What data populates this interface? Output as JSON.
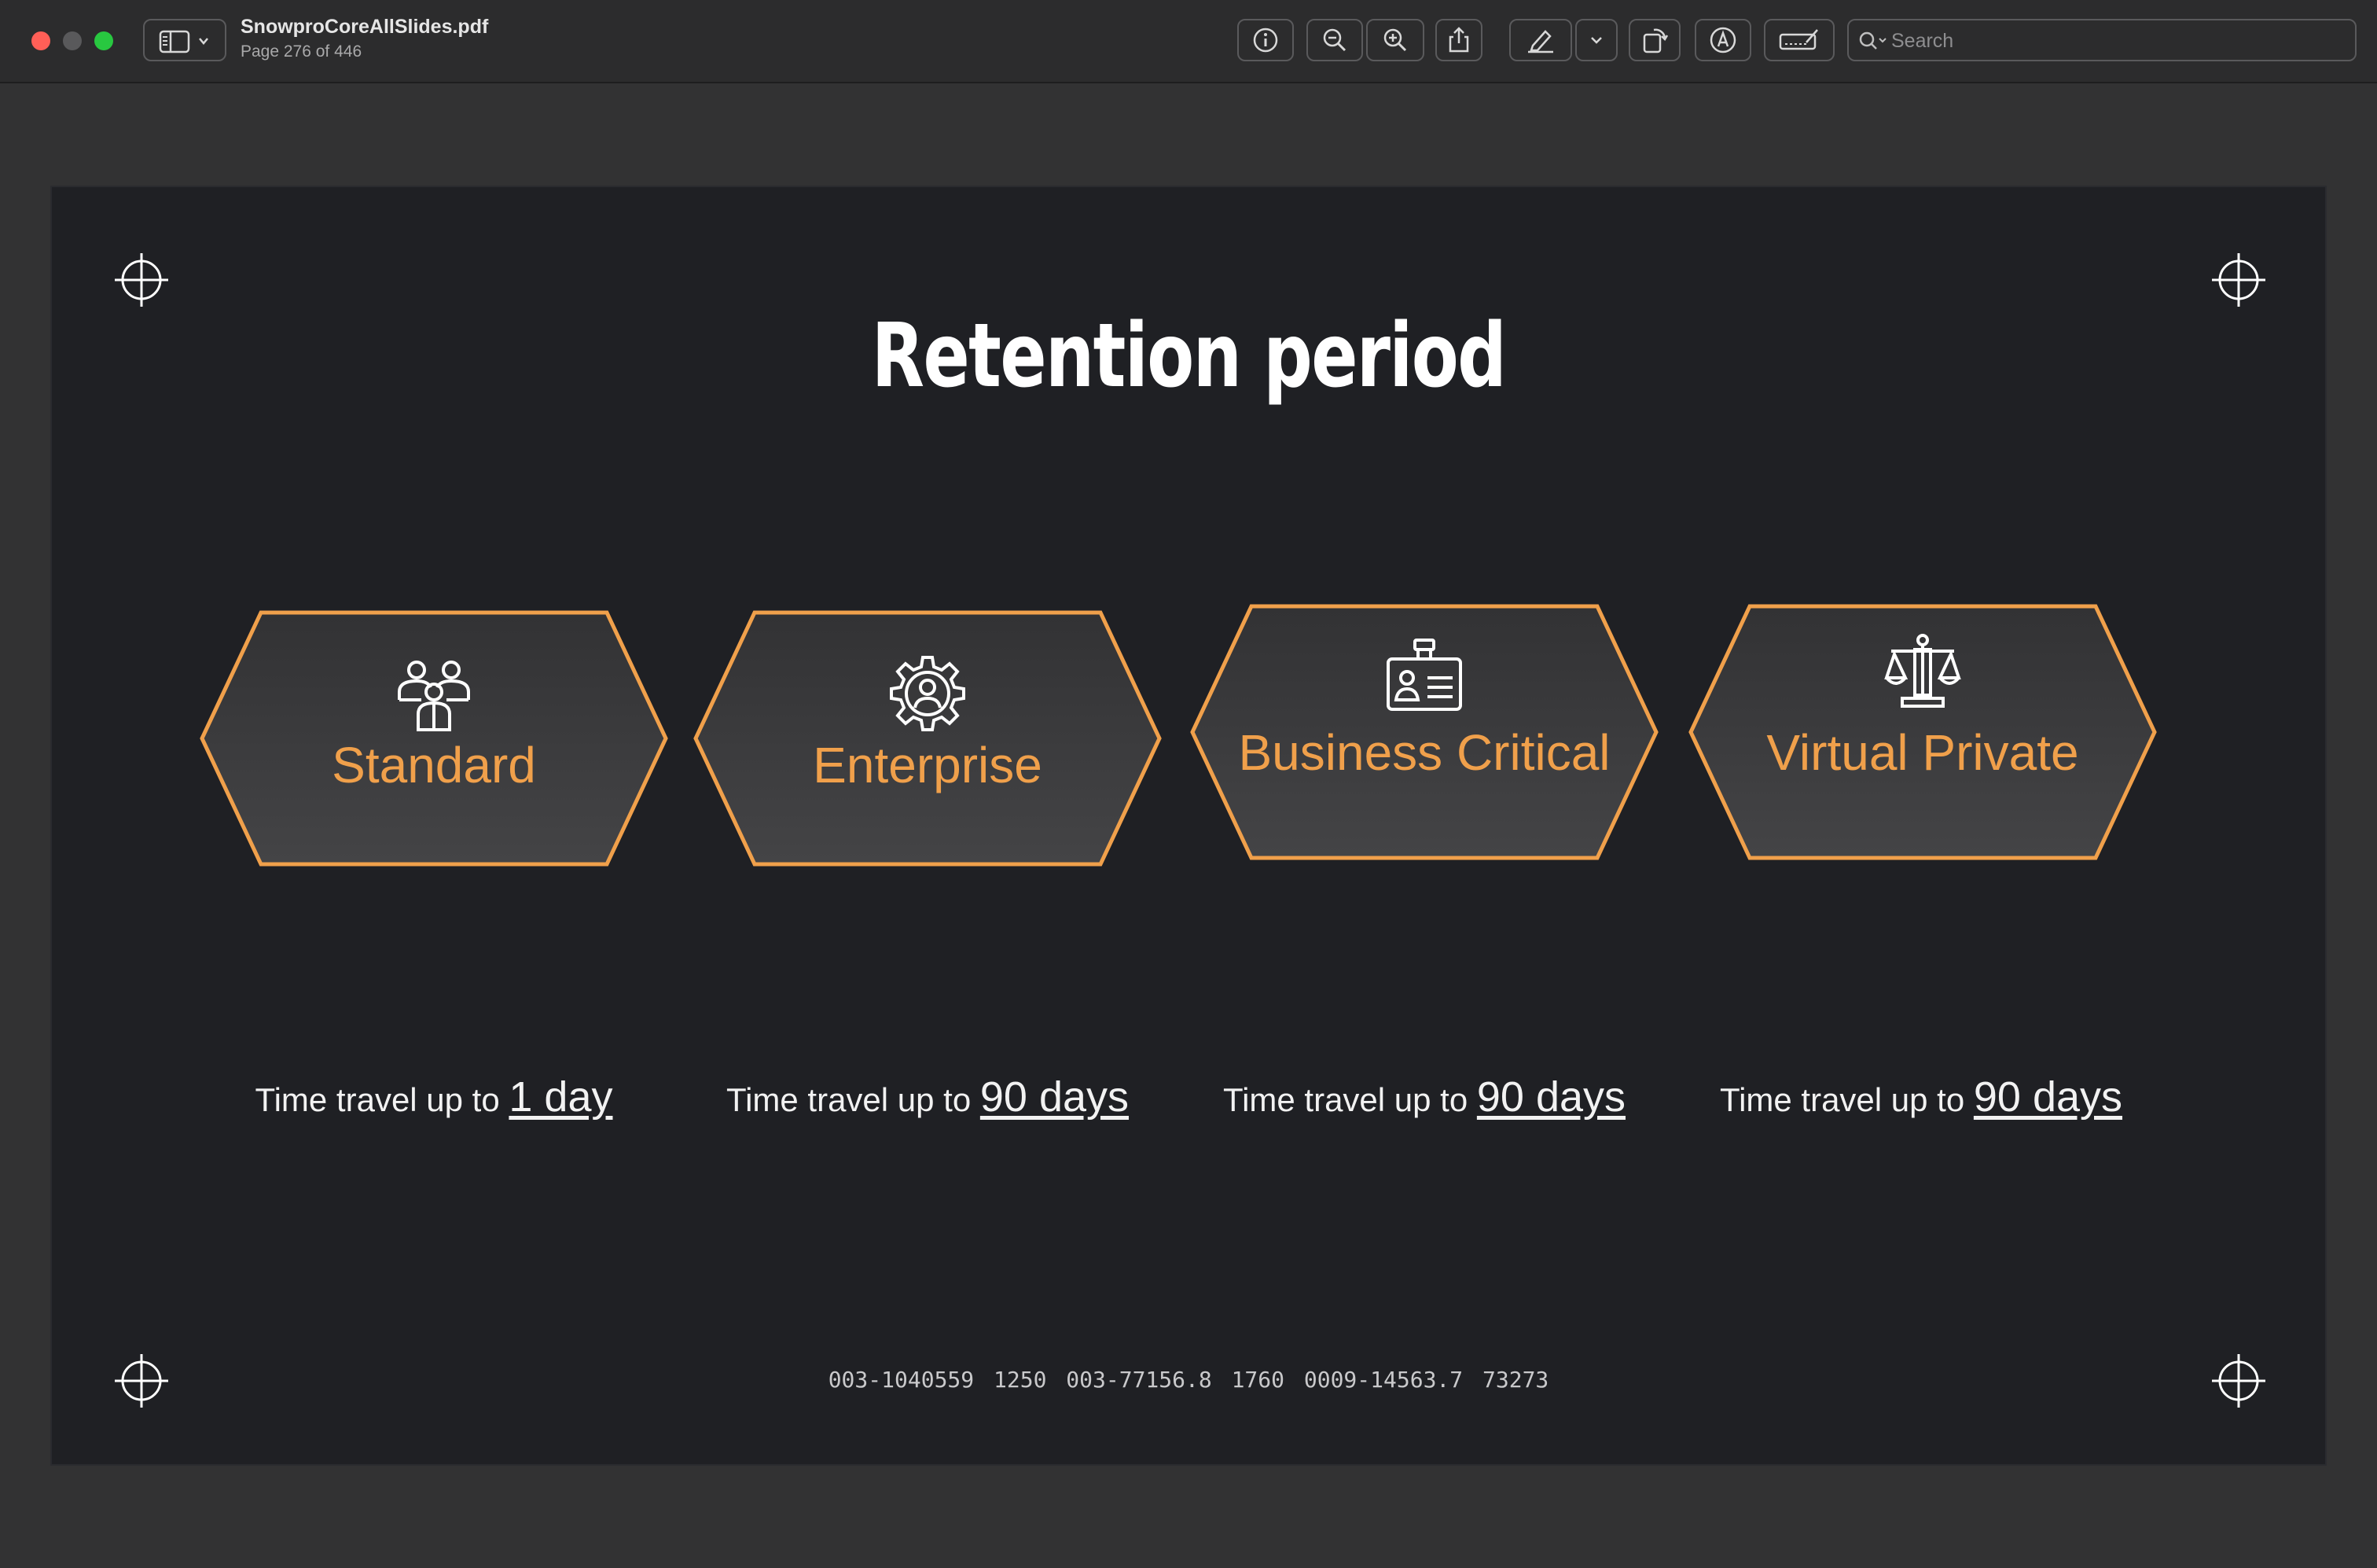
{
  "window": {
    "doc_title": "SnowproCoreAllSlides.pdf",
    "page_info": "Page 276 of 446"
  },
  "toolbar": {
    "search_placeholder": "Search",
    "icons": [
      "info-icon",
      "zoom-out-icon",
      "zoom-in-icon",
      "share-icon",
      "highlight-pen-icon",
      "chevron-down-icon",
      "rotate-icon",
      "markup-icon",
      "signature-icon",
      "search-icon"
    ]
  },
  "slide": {
    "title": "Retention period",
    "editions": [
      {
        "name": "Standard",
        "icon": "people-icon",
        "caption_prefix": "Time travel up to",
        "caption_value": "1 day"
      },
      {
        "name": "Enterprise",
        "icon": "gear-person-icon",
        "caption_prefix": "Time travel up to",
        "caption_value": "90 days"
      },
      {
        "name": "Business Critical",
        "icon": "id-badge-icon",
        "caption_prefix": "Time travel up to",
        "caption_value": "90 days"
      },
      {
        "name": "Virtual Private",
        "icon": "scales-icon",
        "caption_prefix": "Time travel up to",
        "caption_value": "90 days"
      }
    ],
    "footer_code": "003-1040559    1250 003-77156.8   1760 0009-14563.7   73273"
  },
  "colors": {
    "accent": "#f0a04b",
    "slide_bg": "#1f2024",
    "hex_fill": "#3a3a3c",
    "window_bg": "#323233"
  }
}
